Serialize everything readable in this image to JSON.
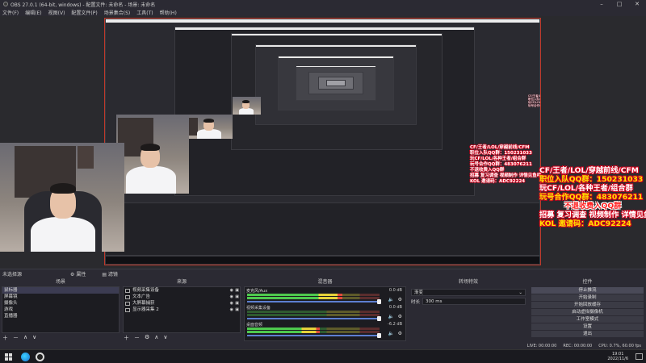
{
  "window": {
    "title": "OBS 27.0.1 (64-bit, windows) - 配置文件: 未命名 - 场景: 未命名",
    "controls": [
      "–",
      "□",
      "✕"
    ]
  },
  "menu": [
    "文件(F)",
    "编辑(E)",
    "视图(V)",
    "配置文件(P)",
    "场景集合(S)",
    "工具(T)",
    "帮助(H)"
  ],
  "overlay": {
    "lines": [
      {
        "text": "CF/王者/LOL/穿越前线/CFM",
        "cls": ""
      },
      {
        "text": "职位入队QQ群：150231033",
        "cls": "y"
      },
      {
        "text": "玩CF/LOL/各种王者/组合群",
        "cls": ""
      },
      {
        "text": "玩号合作QQ群：483076211",
        "cls": "y"
      },
      {
        "text": "不退收费入QQ群",
        "cls": "r"
      },
      {
        "text": "招募 复习调查 视频制作 详情见鱼吧",
        "cls": ""
      },
      {
        "text": "KOL 邀请码：ADC92224",
        "cls": "y"
      }
    ]
  },
  "scene_status": {
    "label": "未选择源",
    "props": "属性",
    "filters": "滤镜"
  },
  "scenes": {
    "title": "场景",
    "items": [
      "鼠标器",
      "屏幕镜",
      "摄像头",
      "游戏",
      "直播器"
    ]
  },
  "sources": {
    "title": "来源",
    "items": [
      "视频采集设备",
      "文本广告",
      "大屏幕捕获",
      "显示器采集 2"
    ]
  },
  "mixer": {
    "title": "混音器",
    "channels": [
      {
        "name": "麦克风/Aux",
        "db": "0.0 dB",
        "level": 0.72
      },
      {
        "name": "视频采集设备",
        "db": "0.0 dB",
        "level": 0.0
      },
      {
        "name": "桌面音频",
        "db": "-6.2 dB",
        "level": 0.55
      }
    ]
  },
  "transitions": {
    "title": "转场特效",
    "type": "渐变",
    "duration_label": "时长",
    "duration": "300 ms"
  },
  "controls": {
    "title": "控件",
    "buttons": [
      "停止推流",
      "开始录制",
      "开始回放缓存",
      "启动虚拟摄像机",
      "工作室模式",
      "设置",
      "退出"
    ]
  },
  "status": {
    "live": "LIVE: 00:00:00",
    "rec": "REC: 00:00:00",
    "cpu": "CPU: 0.7%, 60.00 fps"
  },
  "taskbar": {
    "time": "19:01",
    "date": "2022/11/6"
  },
  "colors": {
    "accent_red": "#d6001c",
    "accent_yellow": "#ffe300",
    "dock_bg": "#2b2a33",
    "panel_bg": "#1c1c21"
  }
}
